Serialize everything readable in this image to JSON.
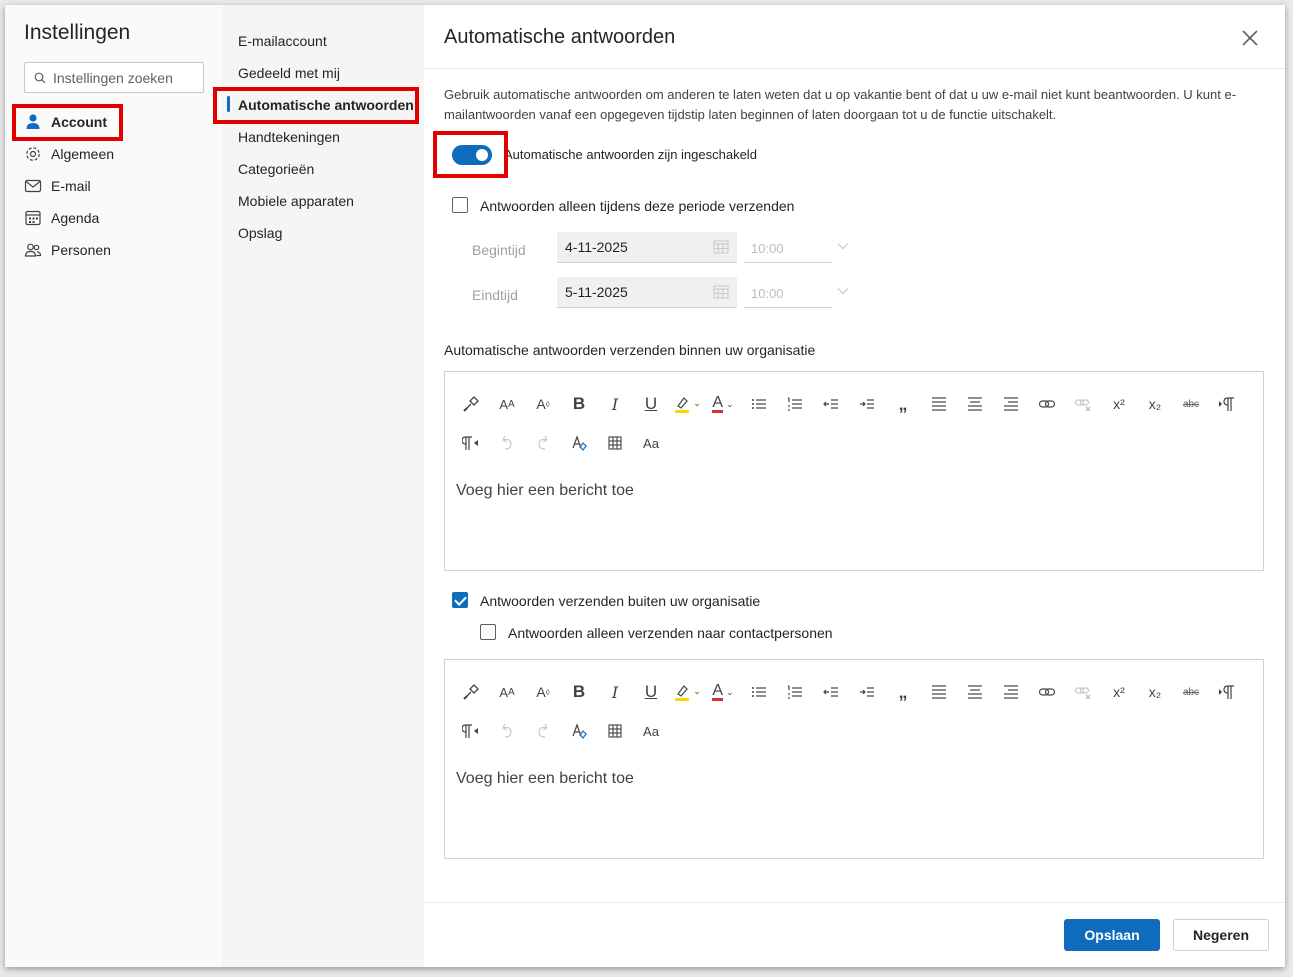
{
  "settings": {
    "title": "Instellingen",
    "search_placeholder": "Instellingen zoeken",
    "nav": [
      "Account",
      "Algemeen",
      "E-mail",
      "Agenda",
      "Personen"
    ],
    "active_nav": "Account"
  },
  "subnav": {
    "items": [
      "E-mailaccount",
      "Gedeeld met mij",
      "Automatische antwoorden",
      "Handtekeningen",
      "Categorieën",
      "Mobiele apparaten",
      "Opslag"
    ],
    "active": "Automatische antwoorden"
  },
  "main": {
    "title": "Automatische antwoorden",
    "description": "Gebruik automatische antwoorden om anderen te laten weten dat u op vakantie bent of dat u uw e-mail niet kunt beantwoorden. U kunt e-mailantwoorden vanaf een opgegeven tijdstip laten beginnen of laten doorgaan tot u de functie uitschakelt.",
    "toggle_label": "Automatische antwoorden zijn ingeschakeld",
    "toggle_on": true,
    "period_label": "Antwoorden alleen tijdens deze periode verzenden",
    "period_checked": false,
    "start_label": "Begintijd",
    "start_date": "4-11-2025",
    "start_time": "10:00",
    "end_label": "Eindtijd",
    "end_date": "5-11-2025",
    "end_time": "10:00",
    "inside_label": "Automatische antwoorden verzenden binnen uw organisatie",
    "editor_placeholder": "Voeg hier een bericht toe",
    "outside_label": "Antwoorden verzenden buiten uw organisatie",
    "outside_checked": true,
    "contacts_label": "Antwoorden alleen verzenden naar contactpersonen",
    "contacts_checked": false,
    "toolbar_text": {
      "bold": "B",
      "italic": "I",
      "underline": "U",
      "quote": "„",
      "superscript": "x²",
      "subscript": "x₂",
      "strike": "abc",
      "case": "Aa"
    }
  },
  "footer": {
    "save": "Opslaan",
    "discard": "Negeren"
  },
  "colors": {
    "accent": "#0f6cbd",
    "highlight_box": "#e00000"
  }
}
